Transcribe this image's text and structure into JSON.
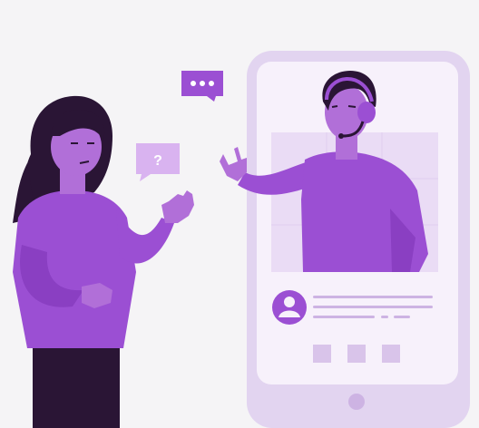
{
  "illustration": {
    "question_bubble_text": "?",
    "chat_bubble_dots": "•••",
    "colors": {
      "background": "#f5f4f6",
      "phone_frame": "#e2d4f0",
      "phone_screen": "#f7f1fb",
      "video_panel": "#eadcf5",
      "accent_purple": "#9b4fd3",
      "dark_purple": "#2a1535",
      "skin": "#b16fd8",
      "placeholder": "#cdb3e3"
    },
    "icons": [
      "user-avatar-icon",
      "headset-icon",
      "question-mark-icon",
      "typing-dots-icon",
      "home-button-icon"
    ]
  }
}
